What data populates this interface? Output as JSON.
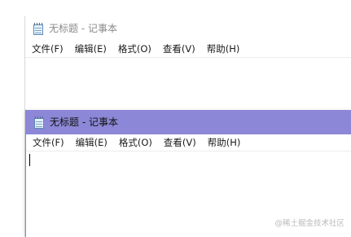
{
  "back_window": {
    "title": "无标题 - 记事本",
    "menu": [
      "文件(F)",
      "编辑(E)",
      "格式(O)",
      "查看(V)",
      "帮助(H)"
    ]
  },
  "front_window": {
    "title": "无标题 - 记事本",
    "menu": [
      "文件(F)",
      "编辑(E)",
      "格式(O)",
      "查看(V)",
      "帮助(H)"
    ],
    "editor_text": ""
  },
  "watermark": "@稀土掘金技术社区",
  "colors": {
    "active_titlebar": "#8c87d6",
    "inactive_title_text": "#8a8a8a"
  },
  "icons": {
    "app": "notepad-icon"
  }
}
